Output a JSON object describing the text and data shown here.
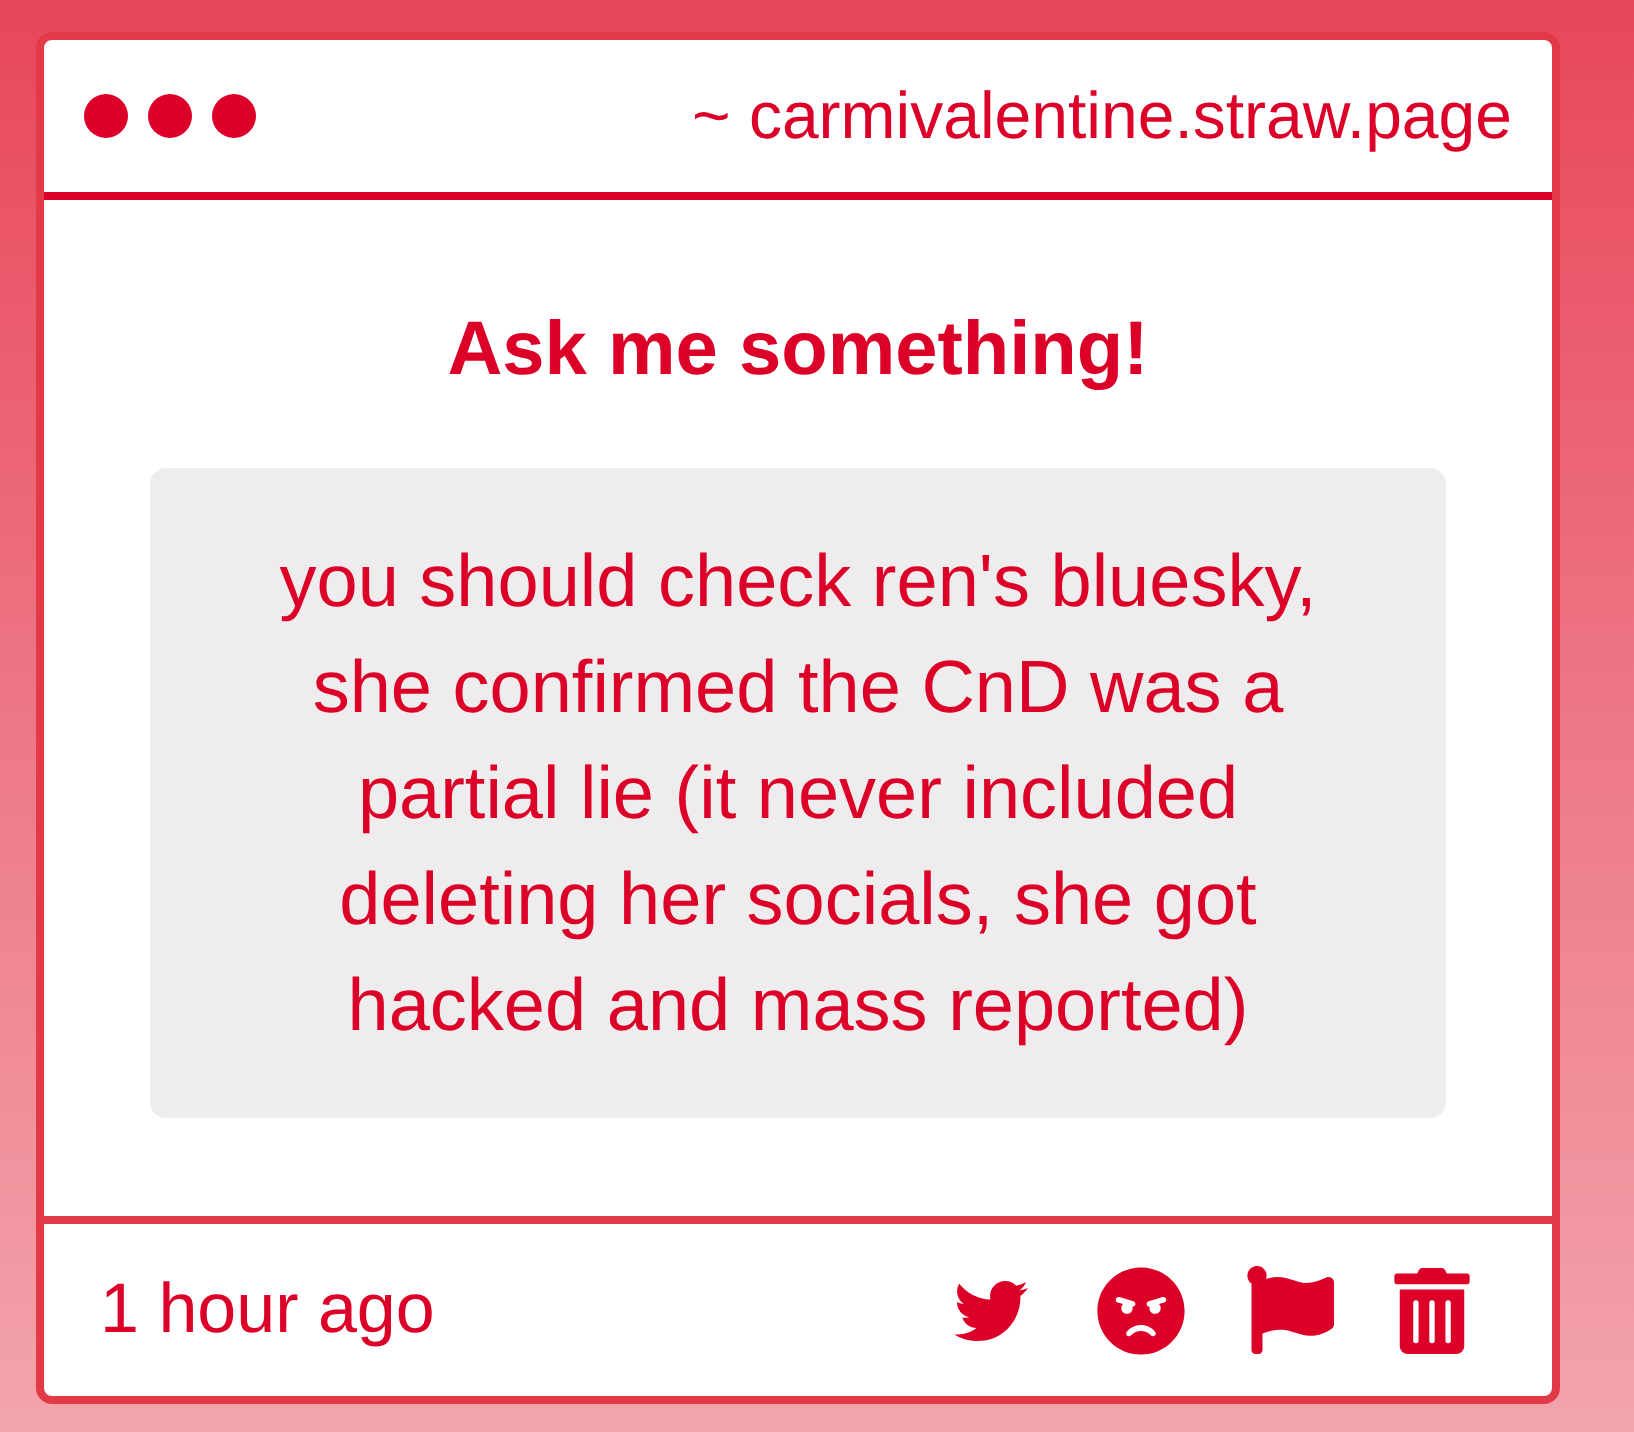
{
  "header": {
    "address": "~ carmivalentine.straw.page"
  },
  "prompt": {
    "title": "Ask me something!"
  },
  "question": {
    "text": "you should check ren's bluesky, she confirmed the CnD was a partial lie (it never included deleting her socials, she got hacked and mass reported)"
  },
  "footer": {
    "time": "1 hour ago",
    "actions": [
      {
        "kind": "share"
      },
      {
        "kind": "react"
      },
      {
        "kind": "report"
      },
      {
        "kind": "delete"
      }
    ]
  }
}
